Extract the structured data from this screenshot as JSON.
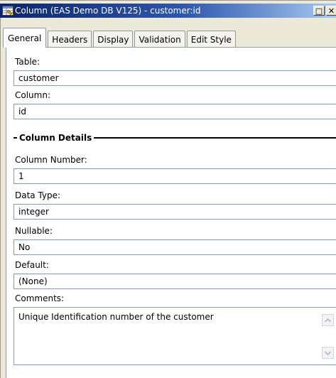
{
  "window": {
    "title": "Column (EAS Demo DB V125) - customer:id",
    "restore_symbol": "□",
    "close_symbol": "✕"
  },
  "tabs": [
    {
      "label": "General",
      "active": true
    },
    {
      "label": "Headers",
      "active": false
    },
    {
      "label": "Display",
      "active": false
    },
    {
      "label": "Validation",
      "active": false
    },
    {
      "label": "Edit Style",
      "active": false
    }
  ],
  "general": {
    "table_label": "Table:",
    "table_value": "customer",
    "column_label": "Column:",
    "column_value": "id",
    "section_title": "Column Details",
    "column_number_label": "Column Number:",
    "column_number_value": "1",
    "data_type_label": "Data Type:",
    "data_type_value": "integer",
    "nullable_label": "Nullable:",
    "nullable_value": "No",
    "default_label": "Default:",
    "default_value": "(None)",
    "comments_label": "Comments:",
    "comments_value": "Unique Identification number of the customer"
  },
  "icons": {
    "title_icon": "column-properties-icon",
    "scroll_up": "chevron-up-icon",
    "scroll_down": "chevron-down-icon"
  },
  "colors": {
    "titlebar_start": "#0a246a",
    "titlebar_end": "#a6caf0",
    "field_border": "#7f9db9",
    "window_face": "#ece9d8"
  }
}
